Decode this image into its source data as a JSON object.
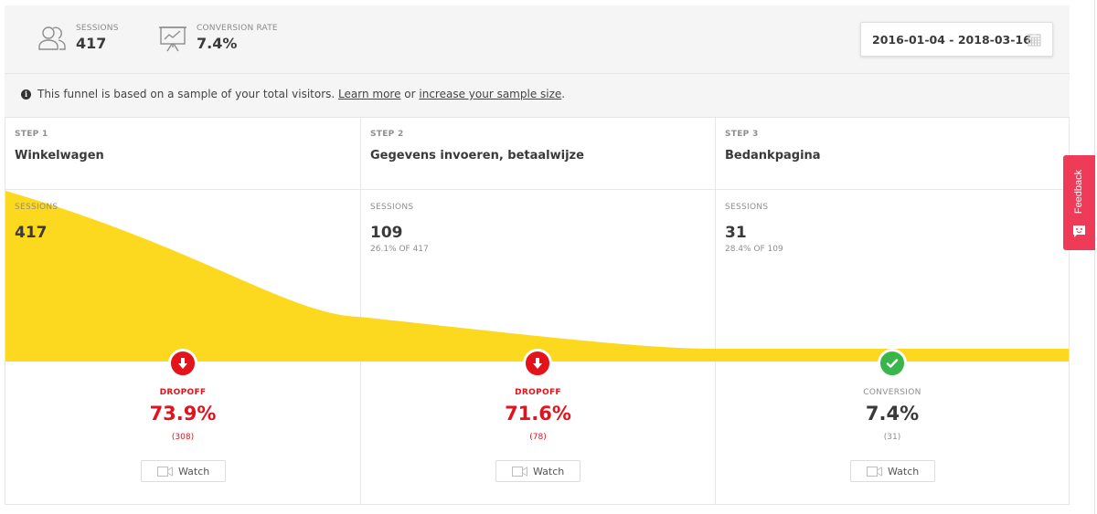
{
  "header": {
    "sessions": {
      "label": "SESSIONS",
      "value": "417",
      "icon": "users-icon"
    },
    "conversion_rate": {
      "label": "CONVERSION RATE",
      "value": "7.4%",
      "icon": "presentation-chart-icon"
    },
    "date_range": {
      "value": "2016-01-04 - 2018-03-16",
      "icon": "calendar-icon"
    }
  },
  "notice": {
    "icon": "info-icon",
    "text_before": "This funnel is based on a sample of your total visitors. ",
    "link_learn_more": "Learn more",
    "text_middle": " or ",
    "link_increase": "increase your sample size",
    "text_after": "."
  },
  "colors": {
    "funnel_fill": "#fcd81e",
    "dropoff": "#e3121b",
    "conversion": "#3ab54a",
    "feedback": "#ee3b57"
  },
  "steps": [
    {
      "step_label": "STEP 1",
      "name": "Winkelwagen",
      "sessions_label": "SESSIONS",
      "sessions": "417",
      "sessions_sub": "",
      "metric_type": "dropoff",
      "metric_label": "DROPOFF",
      "metric_value": "73.9%",
      "metric_count": "(308)",
      "watch_label": "Watch"
    },
    {
      "step_label": "STEP 2",
      "name": "Gegevens invoeren, betaalwijze",
      "sessions_label": "SESSIONS",
      "sessions": "109",
      "sessions_sub": "26.1% OF 417",
      "metric_type": "dropoff",
      "metric_label": "DROPOFF",
      "metric_value": "71.6%",
      "metric_count": "(78)",
      "watch_label": "Watch"
    },
    {
      "step_label": "STEP 3",
      "name": "Bedankpagina",
      "sessions_label": "SESSIONS",
      "sessions": "31",
      "sessions_sub": "28.4% OF 109",
      "metric_type": "conversion",
      "metric_label": "CONVERSION",
      "metric_value": "7.4%",
      "metric_count": "(31)",
      "watch_label": "Watch"
    }
  ],
  "funnel_sessions": [
    417,
    109,
    31
  ],
  "feedback": {
    "label": "Feedback",
    "icon": "smiley-chat-icon"
  }
}
